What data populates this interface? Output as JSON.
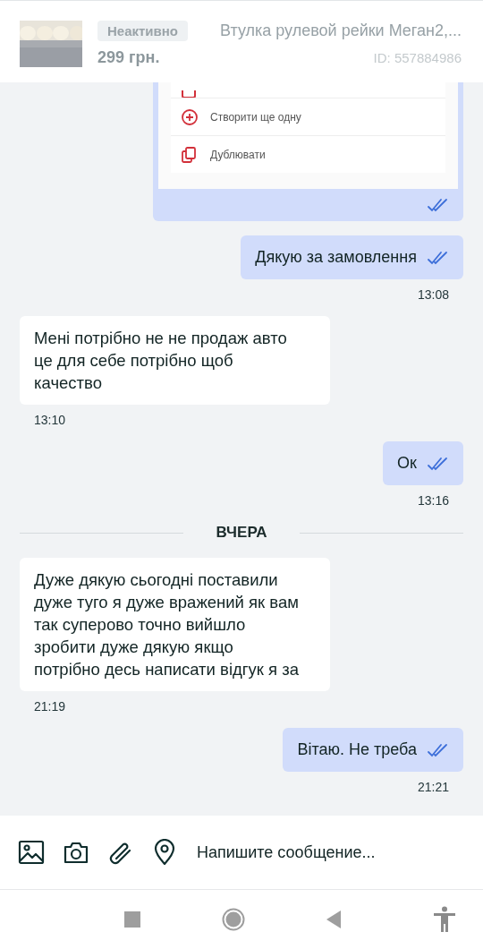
{
  "listing": {
    "status": "Неактивно",
    "title": "Втулка рулевой рейки Меган2,...",
    "price": "299 грн.",
    "id": "ID: 557884986"
  },
  "messages": [
    {
      "kind": "card",
      "outgoing": true,
      "read": true,
      "items": [
        {
          "label": "Створити ще одну"
        },
        {
          "label": "Дублювати"
        }
      ]
    },
    {
      "kind": "text",
      "outgoing": true,
      "read": true,
      "text": "Дякую за замовлення",
      "time": "13:08"
    },
    {
      "kind": "text",
      "outgoing": false,
      "text": "Мені потрібно не не продаж авто це для себе потрібно щоб качество",
      "time": "13:10"
    },
    {
      "kind": "text",
      "outgoing": true,
      "read": true,
      "text": "Ок",
      "time": "13:16"
    },
    {
      "kind": "divider",
      "text": "ВЧЕРА"
    },
    {
      "kind": "text",
      "outgoing": false,
      "text": "Дуже дякую сьогодні поставили дуже туго я дуже вражений як вам так суперово точно вийшло зробити дуже дякую якщо потрібно десь написати відгук я за",
      "time": "21:19"
    },
    {
      "kind": "text",
      "outgoing": true,
      "read": true,
      "text": "Вітаю. Не треба",
      "time": "21:21"
    }
  ],
  "composer": {
    "placeholder": "Напишите сообщение..."
  }
}
